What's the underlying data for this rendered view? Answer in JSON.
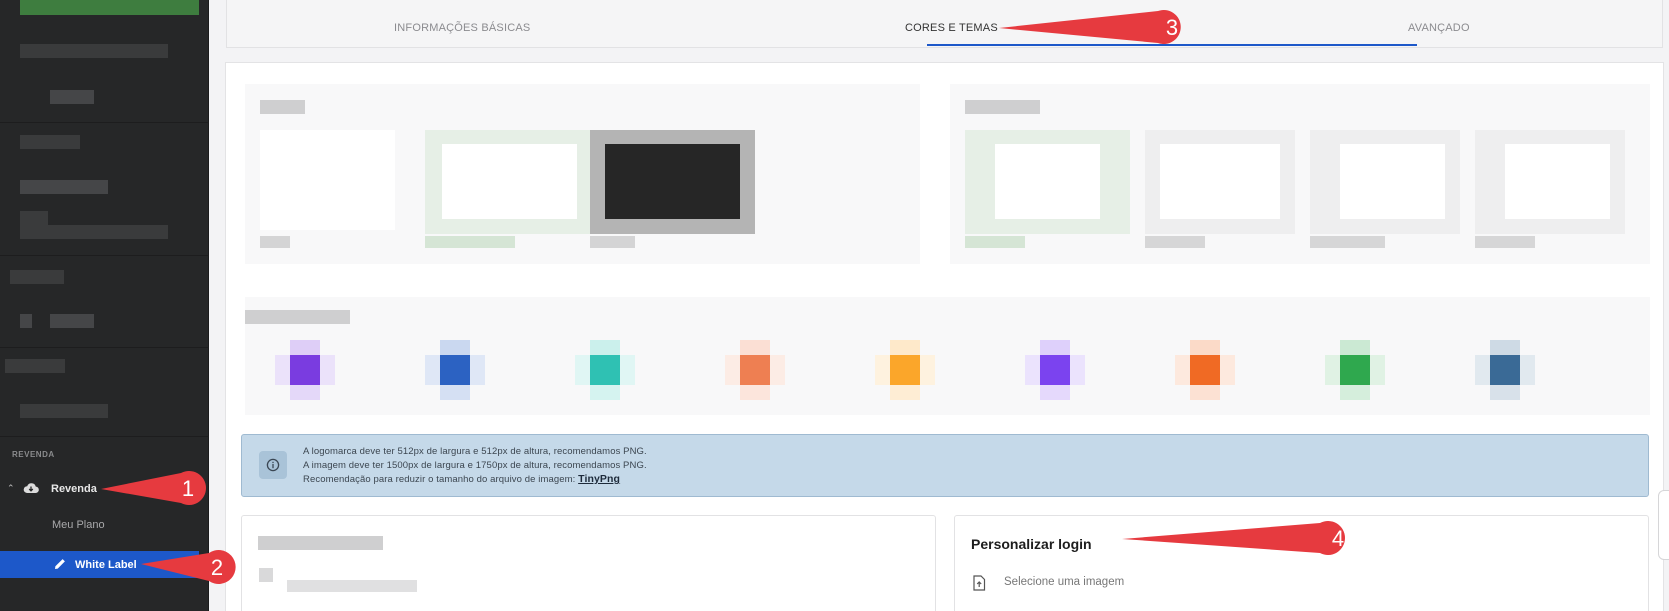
{
  "sidebar": {
    "section_label": "REVENDA",
    "revenda_label": "Revenda",
    "meu_plano_label": "Meu Plano",
    "white_label_label": "White Label",
    "icons": {
      "chevron": "chevron-up-icon",
      "revenda": "cloud-download-icon",
      "white_label": "pencil-icon"
    },
    "accent_color": "#1d58c9"
  },
  "tabs": [
    {
      "label": "INFORMAÇÕES BÁSICAS",
      "active": false
    },
    {
      "label": "CORES E TEMAS",
      "active": true
    },
    {
      "label": "AVANÇADO",
      "active": false
    }
  ],
  "swatches": [
    "#7a3ce0",
    "#2c62c2",
    "#2fc1b3",
    "#ee7f52",
    "#fba62a",
    "#7b43ef",
    "#f06a24",
    "#2fa84e",
    "#3a6a96"
  ],
  "info": {
    "line1": "A logomarca deve ter 512px de largura e 512px de altura, recomendamos PNG.",
    "line2": "A imagem deve ter 1500px de largura e 1750px de altura, recomendamos PNG.",
    "line3_prefix": "Recomendação para reduzir o tamanho do arquivo de imagem:",
    "line3_link": "TinyPng",
    "icon": "info-circle-icon"
  },
  "login_card": {
    "title": "Personalizar login",
    "upload_label": "Selecione uma imagem",
    "upload_icon": "file-upload-icon"
  },
  "annotations": [
    "1",
    "2",
    "3",
    "4"
  ],
  "annotation_color": "#e63a3f"
}
